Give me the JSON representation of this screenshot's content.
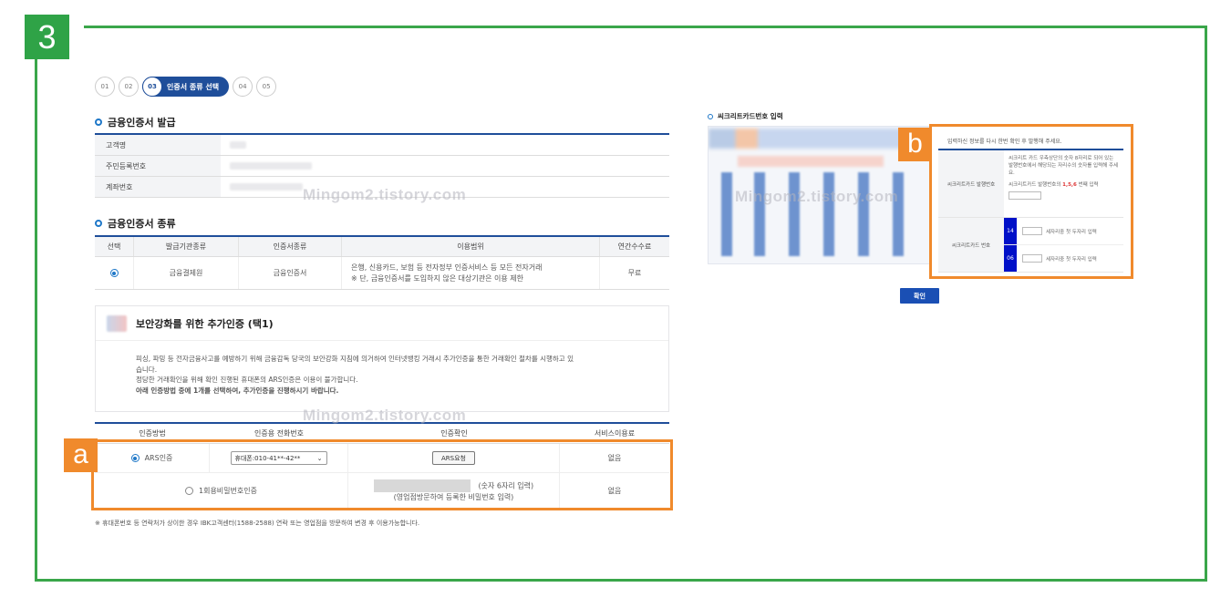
{
  "step_badge": "3",
  "stepper": {
    "steps": [
      "01",
      "02",
      "03",
      "04",
      "05"
    ],
    "active_label": "인증서 종류 선택"
  },
  "issue_section": {
    "title": "금융인증서 발급",
    "rows": [
      {
        "label": "고객명"
      },
      {
        "label": "주민등록번호"
      },
      {
        "label": "계좌번호"
      }
    ]
  },
  "cert_section": {
    "title": "금융인증서 종류",
    "headers": [
      "선택",
      "발급기관종류",
      "인증서종류",
      "이용범위",
      "연간수수료"
    ],
    "row": {
      "issuer": "금융결제원",
      "cert_type": "금융인증서",
      "scope_line1": "은행, 신용카드, 보험 등 전자정부 인증서비스 등 모든 전자거래",
      "scope_line2": "※ 단, 금융인증서를 도입하지 않은 대상기관은 이용 제한",
      "fee": "무료"
    }
  },
  "auth_box": {
    "title": "보안강화를 위한 추가인증 (택1)",
    "desc_line1": "피싱, 파밍 등 전자금융사고를 예방하기 위해 금융감독 당국의 보안강화 지침에 의거하여 인터넷뱅킹 거래시 추가인증을 통한 거래확인 절차를 시행하고 있",
    "desc_line2": "습니다.",
    "desc_line3": "정당한 거래확인을 위해 확인 진행된 휴대폰의 ARS인증은 이용이 불가합니다.",
    "desc_line4": "아래 인증방법 중에 1개를 선택하여, 추가인증을 진행하시기 바랍니다."
  },
  "method_table": {
    "headers": [
      "인증방법",
      "인증용 전화번호",
      "인증확인",
      "서비스이용료"
    ],
    "ars": {
      "label": "ARS인증",
      "phone": "휴대폰:010-41**-42**",
      "button": "ARS요청",
      "fee": "없음"
    },
    "otp": {
      "label": "1회용비밀번호인증",
      "hint1": "(숫자 6자리 입력)",
      "hint2": "(영업점방문하여 등록한 비밀번호 입력)",
      "fee": "없음"
    }
  },
  "footnote": "※ 휴대폰번호 등 연락처가 상이한 경우 IBK고객센터(1588-2588) 연락 또는 영업점을 방문하여 변경 후 이용가능합니다.",
  "watermark": "Mingom2.tistory.com",
  "highlight_a": "a",
  "highlight_b": "b",
  "secret_card": {
    "title": "씨크리트카드번호 입력",
    "head": "입력하신 정보를 다시 한번 확인 후 발행해 주세요.",
    "issue_label": "씨크리트카드 발행번호",
    "issue_desc": "씨크리트 카드 우측상단의 숫자 8자리로 되어 있는 발행번호에서 해당되는 자리수의 숫자를 입력해 주세요.",
    "issue_hint_pre": "씨크리트카드 발행번호의",
    "issue_hint_digits": "1,5,6",
    "issue_hint_post": "번째 입력",
    "number_label": "씨크리트카드 번호",
    "field1_no": "14",
    "field1_hint": "세자리중 첫 두자리 입력",
    "field2_no": "06",
    "field2_hint": "세자리중 첫 두자리 입력",
    "confirm": "확인"
  },
  "colors": {
    "frame_green": "#3aa64a",
    "highlight_orange": "#f08a2c",
    "primary_blue": "#1f4e9a"
  }
}
